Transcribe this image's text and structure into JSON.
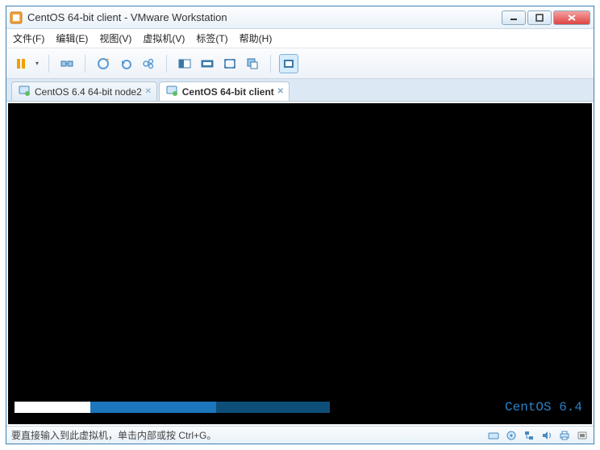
{
  "title": "CentOS 64-bit client - VMware Workstation",
  "menu": {
    "file": "文件(F)",
    "edit": "编辑(E)",
    "view": "视图(V)",
    "vm": "虚拟机(V)",
    "tabs": "标签(T)",
    "help": "帮助(H)"
  },
  "tabs": [
    {
      "label": "CentOS 6.4 64-bit node2",
      "active": false
    },
    {
      "label": "CentOS 64-bit client",
      "active": true
    }
  ],
  "vm": {
    "os_label": "CentOS 6.4"
  },
  "status": {
    "hint": "要直接输入到此虚拟机，单击内部或按 Ctrl+G。"
  },
  "icons": {
    "app": "app-icon",
    "minimize": "minimize-icon",
    "maximize": "maximize-icon",
    "close": "close-icon",
    "pause": "pause-icon",
    "poweroff": "poweroff-icon",
    "snapshot": "snapshot-take-icon",
    "snapshot_revert": "snapshot-revert-icon",
    "snapshot_manager": "snapshot-manager-icon",
    "screen_single": "screen-single-icon",
    "screen_multi": "screen-multi-icon",
    "fullscreen": "fullscreen-icon",
    "unity": "unity-icon",
    "scaling": "scaling-icon",
    "tab_vm": "vm-icon",
    "tab_close": "tab-close-icon",
    "status_hd": "disk-icon",
    "status_cd": "cdrom-icon",
    "status_net": "network-icon",
    "status_sound": "sound-icon",
    "status_input": "input-icon"
  },
  "colors": {
    "accent": "#1b76bc",
    "progress_dark": "#0e4f7a",
    "centos_text": "#2a80c8"
  }
}
